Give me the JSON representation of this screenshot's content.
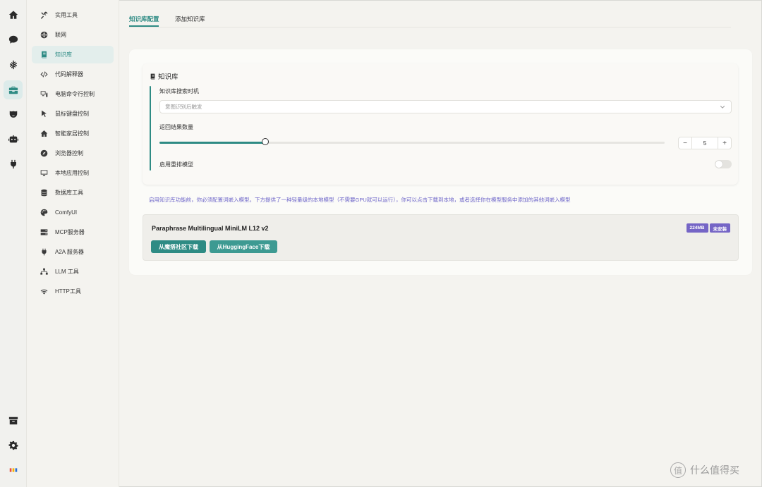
{
  "rail": {
    "top": [
      "home-icon",
      "chat-icon",
      "snowflake-icon",
      "toolbox-icon",
      "mask-icon",
      "robot-icon",
      "plug-icon"
    ],
    "bottom": [
      "archive-icon",
      "gear-icon",
      "app-logo-icon"
    ]
  },
  "sidebar": {
    "items": [
      {
        "label": "实用工具",
        "icon": "tools-icon"
      },
      {
        "label": "联网",
        "icon": "globe-icon"
      },
      {
        "label": "知识库",
        "icon": "book-icon"
      },
      {
        "label": "代码解释器",
        "icon": "code-icon"
      },
      {
        "label": "电脑命令行控制",
        "icon": "terminal-icon"
      },
      {
        "label": "鼠标键盘控制",
        "icon": "cursor-icon"
      },
      {
        "label": "智能家居控制",
        "icon": "house-icon"
      },
      {
        "label": "浏览器控制",
        "icon": "compass-icon"
      },
      {
        "label": "本地应用控制",
        "icon": "monitor-icon"
      },
      {
        "label": "数据库工具",
        "icon": "database-icon"
      },
      {
        "label": "ComfyUI",
        "icon": "palette-icon"
      },
      {
        "label": "MCP服务器",
        "icon": "server-icon"
      },
      {
        "label": "A2A 服务器",
        "icon": "plug-icon"
      },
      {
        "label": "LLM 工具",
        "icon": "network-icon"
      },
      {
        "label": "HTTP工具",
        "icon": "wifi-icon"
      }
    ],
    "active_index": 2
  },
  "tabs": [
    {
      "label": "知识库配置",
      "active": true
    },
    {
      "label": "添加知识库",
      "active": false
    }
  ],
  "kb": {
    "title": "知识库",
    "search_timing_label": "知识库搜索时机",
    "search_timing_value": "意图识别后触发",
    "result_count_label": "返回结果数量",
    "result_count_value": "5",
    "result_count_fraction": 0.21,
    "rerank_label": "启用重排模型",
    "rerank_enabled": false
  },
  "note": "启用知识库功能前，你必须配置词嵌入模型。下方提供了一种轻量级的本地模型（不需要GPU就可以运行），你可以点击下载到本地，或者选择你在模型服务中添加的其他词嵌入模型",
  "model": {
    "name": "Paraphrase Multilingual MiniLM L12 v2",
    "size_badge": "224MB",
    "status_badge": "未安装",
    "download_modelscope": "从魔搭社区下载",
    "download_huggingface": "从HuggingFace下载"
  },
  "watermark": {
    "text": "什么值得买",
    "logo": "值"
  },
  "colors": {
    "accent": "#2e8b84",
    "badge": "#7565c6",
    "note": "#6e66c9"
  }
}
